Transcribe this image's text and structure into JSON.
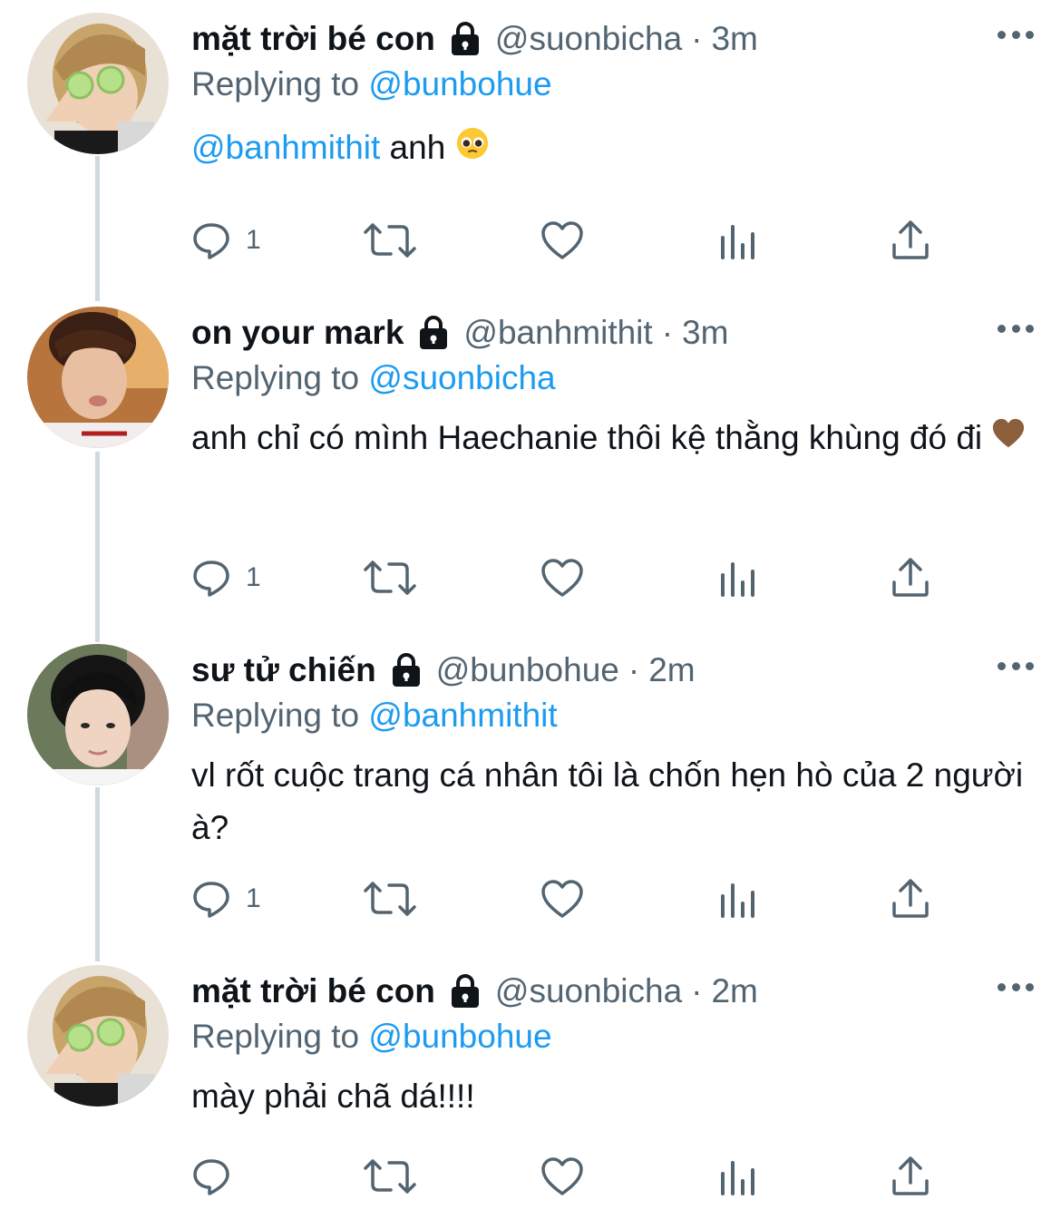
{
  "tweets": [
    {
      "name": "mặt trời bé con",
      "handle": "@suonbicha",
      "dot": "·",
      "time": "3m",
      "replying_prefix": "Replying to",
      "replying_to": "@bunbohue",
      "body_mention": "@banhmithit",
      "body_text": " anh ",
      "body_emoji": "pleading-face",
      "reply_count": "1"
    },
    {
      "name": "on your mark",
      "handle": "@banhmithit",
      "dot": "·",
      "time": "3m",
      "replying_prefix": "Replying to",
      "replying_to": "@suonbicha",
      "body_text": "anh chỉ có mình Haechanie thôi kệ thằng khùng đó đi ",
      "body_emoji": "brown-heart",
      "reply_count": "1"
    },
    {
      "name": "sư tử chiến",
      "handle": "@bunbohue",
      "dot": "·",
      "time": "2m",
      "replying_prefix": "Replying to",
      "replying_to": "@banhmithit",
      "body_text": "vl rốt cuộc trang cá nhân tôi là chốn hẹn hò của 2 người à?",
      "reply_count": "1"
    },
    {
      "name": "mặt trời bé con",
      "handle": "@suonbicha",
      "dot": "·",
      "time": "2m",
      "replying_prefix": "Replying to",
      "replying_to": "@bunbohue",
      "body_text": "mày phải chã dá!!!!",
      "reply_count": ""
    }
  ],
  "icons": {
    "lock": "lock-icon",
    "more": "more-icon",
    "reply": "reply-icon",
    "retweet": "retweet-icon",
    "like": "like-icon",
    "analytics": "analytics-icon",
    "share": "share-icon"
  },
  "colors": {
    "link": "#1d9bf0",
    "secondary": "#536471",
    "thread_line": "#cfd9de"
  }
}
